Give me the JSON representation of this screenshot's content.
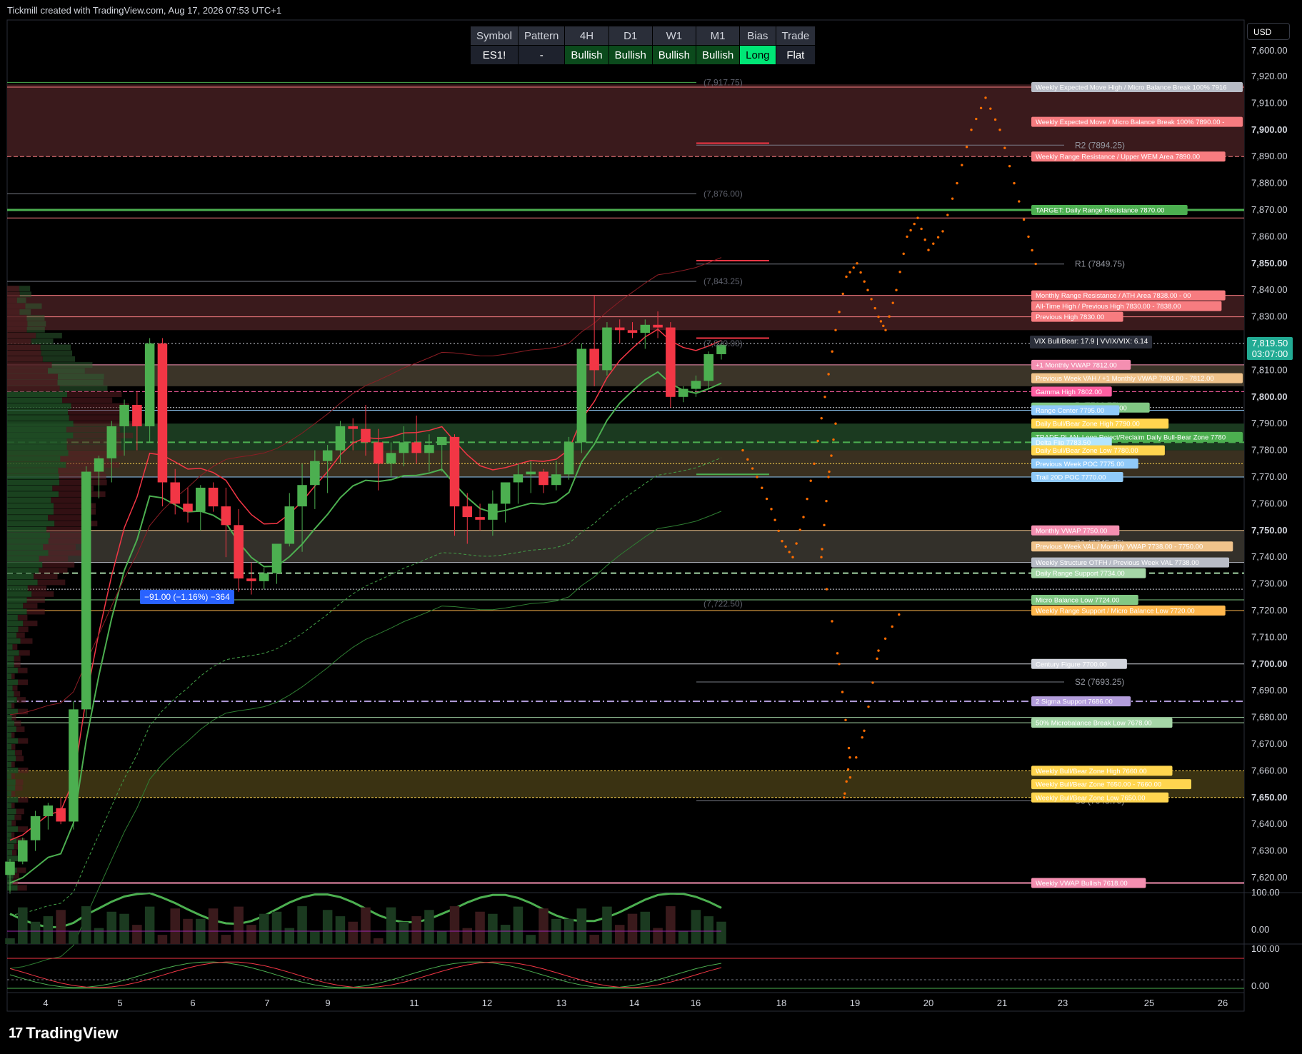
{
  "header": {
    "credit": "Tickmill created with TradingView.com, Aug 17, 2026 07:53 UTC+1"
  },
  "currency": "USD",
  "footer": {
    "brand": "TradingView",
    "logo_icon": "tradingview-logo-icon"
  },
  "table": {
    "headers": [
      "Symbol",
      "Pattern",
      "4H",
      "D1",
      "W1",
      "M1",
      "Bias",
      "Trade"
    ],
    "values": [
      "ES1!",
      "-",
      "Bullish",
      "Bullish",
      "Bullish",
      "Bullish",
      "Long",
      "Flat"
    ]
  },
  "last_price": {
    "price": "7,819.50",
    "countdown": "03:07:00"
  },
  "measure": {
    "text": "−91.00 (−1.16%) −364"
  },
  "vix": {
    "text": "VIX Bull/Bear: 17.9 | VVIX/VIX: 6.14"
  },
  "chart_data": {
    "type": "candlestick",
    "symbol": "ES1!",
    "ylim": [
      7610,
      7925
    ],
    "y_ticks": [
      "7,620.00",
      "7,630.00",
      "7,640.00",
      "7,650.00",
      "7,660.00",
      "7,670.00",
      "7,680.00",
      "7,690.00",
      "7,700.00",
      "7,710.00",
      "7,720.00",
      "7,730.00",
      "7,740.00",
      "7,750.00",
      "7,760.00",
      "7,770.00",
      "7,780.00",
      "7,790.00",
      "7,800.00",
      "7,810.00",
      "7,820.00",
      "7,830.00",
      "7,840.00",
      "7,850.00",
      "7,860.00",
      "7,870.00",
      "7,880.00",
      "7,890.00",
      "7,900.00",
      "7,910.00",
      "7,920.00"
    ],
    "y_tick_values": [
      7620,
      7630,
      7640,
      7650,
      7660,
      7670,
      7680,
      7690,
      7700,
      7710,
      7720,
      7730,
      7740,
      7750,
      7760,
      7770,
      7780,
      7790,
      7800,
      7810,
      7820,
      7830,
      7840,
      7850,
      7860,
      7870,
      7880,
      7890,
      7900,
      7910,
      7920
    ],
    "y_top_label": "7,600.00",
    "x_ticks": [
      "4",
      "5",
      "6",
      "7",
      "9",
      "11",
      "12",
      "13",
      "14",
      "16",
      "18",
      "19",
      "20",
      "21",
      "23",
      "25",
      "26"
    ],
    "candles": [
      [
        7621,
        7627,
        7614,
        7626
      ],
      [
        7626,
        7635,
        7625,
        7634
      ],
      [
        7634,
        7645,
        7630,
        7643
      ],
      [
        7643,
        7648,
        7638,
        7647
      ],
      [
        7646,
        7650,
        7640,
        7641
      ],
      [
        7641,
        7686,
        7638,
        7683
      ],
      [
        7683,
        7774,
        7680,
        7772
      ],
      [
        7772,
        7778,
        7762,
        7777
      ],
      [
        7777,
        7791,
        7768,
        7789
      ],
      [
        7789,
        7799,
        7778,
        7797
      ],
      [
        7797,
        7802,
        7780,
        7789
      ],
      [
        7789,
        7822,
        7783,
        7820
      ],
      [
        7820,
        7822,
        7759,
        7768
      ],
      [
        7768,
        7773,
        7756,
        7760
      ],
      [
        7760,
        7766,
        7753,
        7757
      ],
      [
        7757,
        7767,
        7750,
        7766
      ],
      [
        7766,
        7768,
        7757,
        7759
      ],
      [
        7759,
        7766,
        7740,
        7752
      ],
      [
        7752,
        7758,
        7727,
        7732
      ],
      [
        7732,
        7738,
        7726,
        7731
      ],
      [
        7731,
        7736,
        7728,
        7734
      ],
      [
        7734,
        7745,
        7730,
        7745
      ],
      [
        7745,
        7764,
        7744,
        7759
      ],
      [
        7759,
        7775,
        7742,
        7767
      ],
      [
        7767,
        7780,
        7758,
        7776
      ],
      [
        7776,
        7782,
        7764,
        7780
      ],
      [
        7780,
        7791,
        7775,
        7789
      ],
      [
        7789,
        7792,
        7780,
        7788
      ],
      [
        7788,
        7797,
        7778,
        7783
      ],
      [
        7783,
        7788,
        7765,
        7775
      ],
      [
        7775,
        7783,
        7770,
        7779
      ],
      [
        7779,
        7789,
        7774,
        7783
      ],
      [
        7783,
        7793,
        7775,
        7779
      ],
      [
        7779,
        7786,
        7772,
        7782
      ],
      [
        7782,
        7785,
        7772,
        7785
      ],
      [
        7785,
        7786,
        7748,
        7759
      ],
      [
        7759,
        7764,
        7745,
        7755
      ],
      [
        7755,
        7760,
        7750,
        7754
      ],
      [
        7754,
        7765,
        7748,
        7760
      ],
      [
        7760,
        7768,
        7753,
        7768
      ],
      [
        7768,
        7775,
        7760,
        7771
      ],
      [
        7771,
        7776,
        7764,
        7772
      ],
      [
        7772,
        7773,
        7764,
        7767
      ],
      [
        7767,
        7776,
        7765,
        7771
      ],
      [
        7771,
        7785,
        7769,
        7783
      ],
      [
        7783,
        7820,
        7779,
        7818
      ],
      [
        7818,
        7838,
        7804,
        7810
      ],
      [
        7810,
        7828,
        7808,
        7826
      ],
      [
        7826,
        7829,
        7820,
        7825
      ],
      [
        7825,
        7828,
        7822,
        7824
      ],
      [
        7824,
        7829,
        7818,
        7827
      ],
      [
        7827,
        7832,
        7822,
        7826
      ],
      [
        7826,
        7828,
        7796,
        7800
      ],
      [
        7800,
        7804,
        7798,
        7803
      ],
      [
        7803,
        7808,
        7800,
        7806
      ],
      [
        7806,
        7817,
        7803,
        7816
      ],
      [
        7816,
        7820,
        7814,
        7819.5
      ]
    ],
    "horizontal_levels": [
      {
        "price": 7917.75,
        "label": "(7,917.75)"
      },
      {
        "price": 7876.0,
        "label": "(7,876.00)"
      },
      {
        "price": 7843.25,
        "label": "(7,843.25)"
      },
      {
        "price": 7820.0,
        "label": "(7,820.00)"
      },
      {
        "price": 7722.5,
        "label": "(7,722.50)"
      }
    ],
    "pivots": [
      {
        "name": "R2",
        "label": "R2 (7894.25)",
        "price": 7894.25
      },
      {
        "name": "R1",
        "label": "R1 (7849.75)",
        "price": 7849.75
      },
      {
        "name": "P",
        "label": "P (7796.75)",
        "price": 7796.75
      },
      {
        "name": "S1",
        "label": "S1 (7745.25)",
        "price": 7745.25
      },
      {
        "name": "S2",
        "label": "S2 (7693.25)",
        "price": 7693.25
      },
      {
        "name": "S3",
        "label": "S3 (7648.75)",
        "price": 7648.75
      }
    ],
    "level_labels": [
      {
        "text": "Weekly Expected Move High / Micro Balance Break 100%  7916",
        "price": 7916,
        "color": "#b8bcc6"
      },
      {
        "text": "Weekly Expected Move / Micro Balance Break 100%  7890.00 -",
        "price": 7903,
        "color": "#f77c80"
      },
      {
        "text": "Weekly Range Resistance / Upper WEM Area  7890.00",
        "price": 7890,
        "color": "#f77c80"
      },
      {
        "text": "TARGET: Daily Range Resistance  7870.00",
        "price": 7870,
        "color": "#4caf50"
      },
      {
        "text": "Monthly Range Resistance / ATH Area  7838.00 - 00",
        "price": 7838,
        "color": "#f77c80"
      },
      {
        "text": "All-Time High / Previous High  7830.00 - 7838.00",
        "price": 7834,
        "color": "#f77c80"
      },
      {
        "text": "Previous High  7830.00",
        "price": 7830,
        "color": "#f77c80"
      },
      {
        "text": "+1 Monthly VWAP  7812.00",
        "price": 7812,
        "color": "#f48fb1"
      },
      {
        "text": "Previous Week VAH / +1 Monthly VWAP  7804.00 - 7812.00",
        "price": 7807,
        "color": "#f0c38b"
      },
      {
        "text": "Gamma High  7802.00",
        "price": 7802,
        "color": "#ff5fa2"
      },
      {
        "text": "Daily Structure OTFH  7796.00",
        "price": 7796,
        "color": "#81c784"
      },
      {
        "text": "Range Center  7795.00",
        "price": 7795,
        "color": "#90caf9"
      },
      {
        "text": "Daily Bull/Bear Zone High  7790.00",
        "price": 7790,
        "color": "#ffd54f"
      },
      {
        "text": "TRADE PLAN: Long Reject/Reclaim Daily Bull-Bear Zone  7780",
        "price": 7785,
        "color": "#4caf50"
      },
      {
        "text": "Delta Flip  7783.50",
        "price": 7783,
        "color": "#b3e5fc"
      },
      {
        "text": "Daily Bull/Bear Zone Low  7780.00",
        "price": 7780,
        "color": "#ffd54f"
      },
      {
        "text": "Previous Week POC  7775.00",
        "price": 7775,
        "color": "#90caf9"
      },
      {
        "text": "Trail 20D POC  7770.00",
        "price": 7770,
        "color": "#90caf9"
      },
      {
        "text": "Monthly VWAP  7750.00",
        "price": 7750,
        "color": "#f48fb1"
      },
      {
        "text": "Previous Week VAL / Monthly VWAP  7738.00 - 7750.00",
        "price": 7744,
        "color": "#f0c38b"
      },
      {
        "text": "Weekly Structure OTFH / Previous Week VAL  7738.00",
        "price": 7738,
        "color": "#b8bcc6"
      },
      {
        "text": "Daily Range Support  7734.00",
        "price": 7734,
        "color": "#a5d6a7"
      },
      {
        "text": "Micro Balance Low  7724.00",
        "price": 7724,
        "color": "#81c784"
      },
      {
        "text": "Weekly Range Support / Micro Balance Low  7720.00",
        "price": 7720,
        "color": "#ffb74d"
      },
      {
        "text": "Century Figure  7700.00",
        "price": 7700,
        "color": "#d1d4dc"
      },
      {
        "text": "2 Sigma Support  7686.00",
        "price": 7686,
        "color": "#b39ddb"
      },
      {
        "text": "50% Microbalance Break Low  7678.00",
        "price": 7678,
        "color": "#a5d6a7"
      },
      {
        "text": "Weekly Bull/Bear Zone High  7660.00",
        "price": 7660,
        "color": "#ffd54f"
      },
      {
        "text": "Weekly Bull/Bear Zone  7650.00 - 7660.00",
        "price": 7655,
        "color": "#ffd54f"
      },
      {
        "text": "Weekly Bull/Bear Zone Low  7650.00",
        "price": 7650,
        "color": "#ffd54f"
      },
      {
        "text": "Weekly VWAP Bullish  7618.00",
        "price": 7618,
        "color": "#f48fb1"
      }
    ],
    "lower_panel_1": {
      "ticks": [
        "100.00",
        "0.00"
      ]
    },
    "lower_panel_2": {
      "ticks": [
        "100.00",
        "0.00"
      ]
    },
    "colors": {
      "up": "#4caf50",
      "down": "#f23645",
      "bg": "#000000",
      "grid": "#1c1f26",
      "projection": "#ff6d00"
    }
  }
}
